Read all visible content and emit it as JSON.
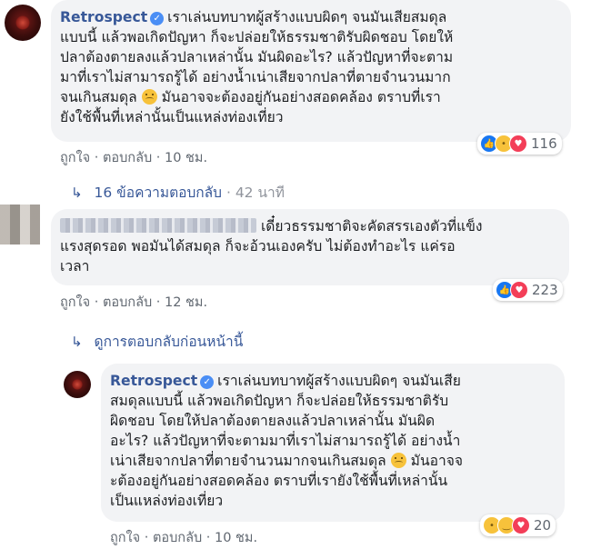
{
  "comments": [
    {
      "author": "Retrospect",
      "text_line1": "เราเล่นบทบาทผู้สร้างแบบผิดๆ จนมันเสียสมดุล",
      "text_lines": [
        "แบบนี้ แล้วพอเกิดปัญหา ก็จะปล่อยให้ธรรมชาติรับผิดชอบ โดยให้",
        "ปลาต้องตายลงแล้วปลาเหล่านั้น มันผิดอะไร? แล้วปัญหาที่จะตาม",
        "มาที่เราไม่สามารถรู้ได้ อย่างน้ำเน่าเสียจากปลาที่ตายจำนวนมาก",
        "จนเกินสมดุล",
        "มันอาจจะต้องอยู่กันอย่างสอดคล้อง ตราบที่เรา",
        "ยังใช้พื้นที่เหล่านั้นเป็นแหล่งท่องเที่ยว"
      ],
      "like_label": "ถูกใจ",
      "reply_label": "ตอบกลับ",
      "time": "10 ชม.",
      "reaction_count": "116",
      "reactions": [
        "like-icon",
        "sad-icon",
        "love-icon"
      ]
    },
    {
      "author_hidden": true,
      "text_line1": "เดี๋ยวธรรมชาติจะคัดสรรเองตัวที่แข็ง",
      "text_lines": [
        "แรงสุดรอด พอมันได้สมดุล ก็จะอ้วนเองครับ ไม่ต้องทำอะไร แค่รอ",
        "เวลา"
      ],
      "like_label": "ถูกใจ",
      "reply_label": "ตอบกลับ",
      "time": "12 ชม.",
      "reaction_count": "223",
      "reactions": [
        "like-icon",
        "love-icon"
      ]
    },
    {
      "author": "Retrospect",
      "text_line1": "เราเล่นบทบาทผู้สร้างแบบผิดๆ จนมันเสีย",
      "text_lines": [
        "สมดุลแบบนี้ แล้วพอเกิดปัญหา ก็จะปล่อยให้ธรรมชาติรับ",
        "ผิดชอบ โดยให้ปลาต้องตายลงแล้วปลาเหล่านั้น มันผิด",
        "อะไร? แล้วปัญหาที่จะตามมาที่เราไม่สามารถรู้ได้ อย่างน้ำ",
        "เน่าเสียจากปลาที่ตายจำนวนมากจนเกินสมดุล",
        "มันอาจจ",
        "ะต้องอยู่กันอย่างสอดคล้อง ตราบที่เรายังใช้พื้นที่เหล่านั้น",
        "เป็นแหล่งท่องเที่ยว"
      ],
      "like_label": "ถูกใจ",
      "reply_label": "ตอบกลับ",
      "time": "10 ชม.",
      "reaction_count": "20",
      "reactions": [
        "sad-icon",
        "haha-icon",
        "love-icon"
      ]
    }
  ],
  "replies_link": {
    "label": "16 ข้อความตอบกลับ",
    "time": "42 นาที"
  },
  "previous_replies_link": {
    "label": "ดูการตอบกลับก่อนหน้านี้"
  },
  "separator": "·"
}
